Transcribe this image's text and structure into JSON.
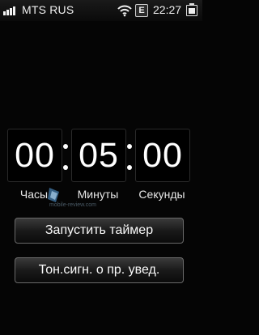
{
  "status_bar": {
    "operator": "MTS RUS",
    "network_badge": "E",
    "time": "22:27",
    "icons": [
      "signal-icon",
      "wifi-icon",
      "edge-icon",
      "battery-icon"
    ]
  },
  "timer": {
    "hours": "00",
    "minutes": "05",
    "seconds": "00",
    "hours_label": "Часы",
    "minutes_label": "Минуты",
    "seconds_label": "Секунды"
  },
  "buttons": {
    "start_label": "Запустить таймер",
    "tone_label": "Тон.сигн. о пр. увед."
  },
  "watermark": {
    "text": "mobile-review.com"
  }
}
